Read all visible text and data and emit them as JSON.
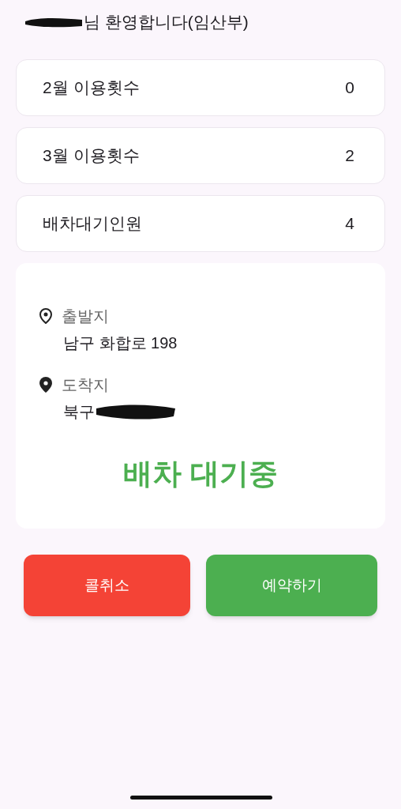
{
  "greeting": "님 환영합니다(임산부)",
  "stats": [
    {
      "label": "2월 이용횟수",
      "value": "0"
    },
    {
      "label": "3월 이용횟수",
      "value": "2"
    },
    {
      "label": "배차대기인원",
      "value": "4"
    }
  ],
  "route": [
    {
      "kind": "origin",
      "label": "출발지",
      "address": "남구 화합로 198"
    },
    {
      "kind": "destination",
      "label": "도착지",
      "address": "북구"
    }
  ],
  "status": "배차 대기중",
  "buttons": [
    {
      "kind": "cancel",
      "label": "콜취소"
    },
    {
      "kind": "reserve",
      "label": "예약하기"
    }
  ]
}
